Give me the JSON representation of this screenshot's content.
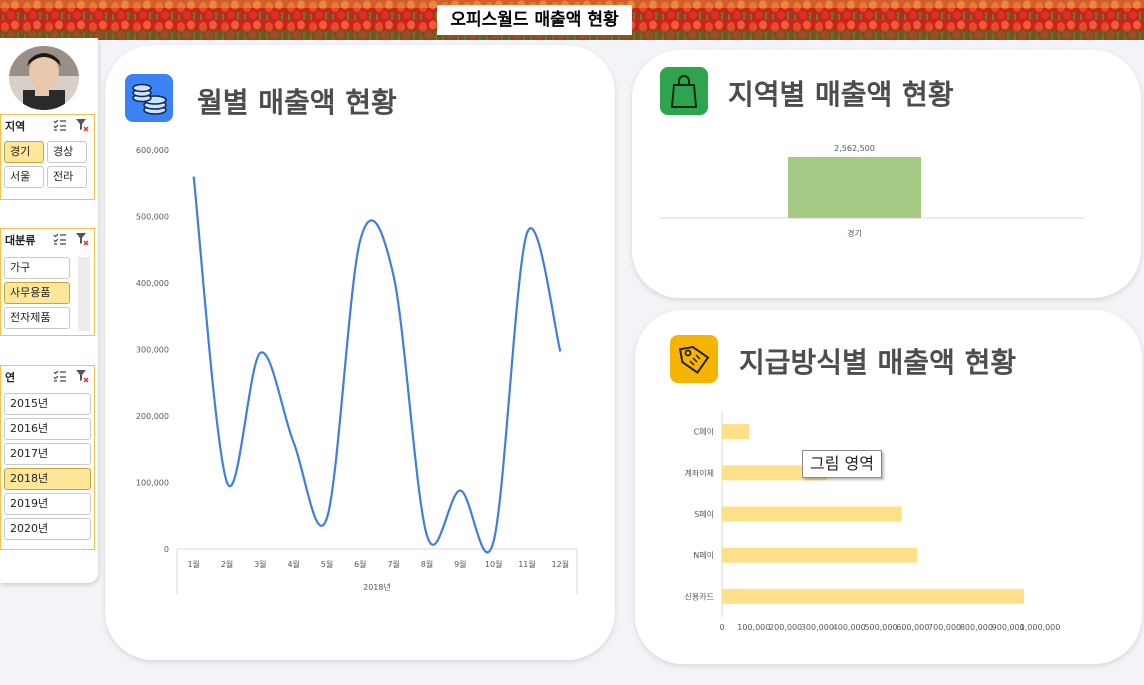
{
  "banner": {
    "title": "오피스월드 매출액 현황"
  },
  "slicers": {
    "region": {
      "header": "지역",
      "items": [
        {
          "label": "경기",
          "selected": true
        },
        {
          "label": "경상",
          "selected": false
        },
        {
          "label": "서울",
          "selected": false
        },
        {
          "label": "전라",
          "selected": false
        }
      ]
    },
    "category": {
      "header": "대분류",
      "items": [
        {
          "label": "가구",
          "selected": false
        },
        {
          "label": "사무용품",
          "selected": true
        },
        {
          "label": "전자제품",
          "selected": false
        }
      ]
    },
    "year": {
      "header": "연",
      "items": [
        {
          "label": "2015년",
          "selected": false
        },
        {
          "label": "2016년",
          "selected": false
        },
        {
          "label": "2017년",
          "selected": false
        },
        {
          "label": "2018년",
          "selected": true
        },
        {
          "label": "2019년",
          "selected": false
        },
        {
          "label": "2020년",
          "selected": false
        }
      ]
    }
  },
  "cards": {
    "monthly": {
      "title": "월별 매출액 현황",
      "icon": "coins-icon",
      "tile_color": "#3b82f6"
    },
    "region": {
      "title": "지역별 매출액 현황",
      "icon": "shopping-bag-icon",
      "tile_color": "#2ea44f"
    },
    "payment": {
      "title": "지급방식별 매출액 현황",
      "icon": "price-tag-icon",
      "tile_color": "#f4b400"
    }
  },
  "tooltip": {
    "text": "그림 영역"
  },
  "chart_data": [
    {
      "type": "line",
      "categories": [
        "1월",
        "2월",
        "3월",
        "4월",
        "5월",
        "6월",
        "7월",
        "8월",
        "9월",
        "10월",
        "11월",
        "12월"
      ],
      "values": [
        560000,
        100000,
        295000,
        160000,
        47000,
        465000,
        410000,
        20000,
        88000,
        12000,
        475000,
        297000
      ],
      "xlabel": "2018년",
      "y_ticks": [
        "0",
        "100,000",
        "200,000",
        "300,000",
        "400,000",
        "500,000",
        "600,000"
      ],
      "ylim": [
        0,
        600000
      ],
      "color": "#3f7fdb",
      "grid": false
    },
    {
      "type": "bar",
      "categories": [
        "경기"
      ],
      "values": [
        2562500
      ],
      "data_labels": [
        "2,562,500"
      ],
      "color": "#a5ca86"
    },
    {
      "type": "bar",
      "orientation": "horizontal",
      "categories": [
        "C페이",
        "계좌이체",
        "S페이",
        "N페이",
        "신용카드"
      ],
      "values": [
        85000,
        330000,
        565000,
        615000,
        950000
      ],
      "x_ticks": [
        "0",
        "100,000",
        "200,000",
        "300,000",
        "400,000",
        "500,000",
        "600,000",
        "700,000",
        "800,000",
        "900,000",
        "1,000,000"
      ],
      "xlim": [
        0,
        1000000
      ],
      "color": "#ffe08a",
      "grid": false
    }
  ]
}
